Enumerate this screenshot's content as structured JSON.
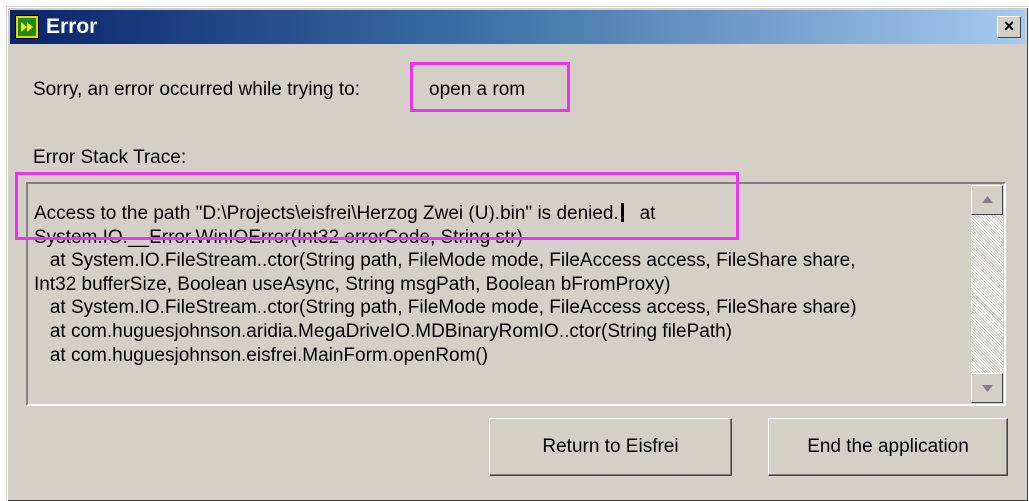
{
  "window": {
    "title": "Error",
    "close_glyph": "×"
  },
  "message": {
    "label": "Sorry, an error occurred while trying to:",
    "action": "open a rom"
  },
  "stack": {
    "label": "Error Stack Trace:",
    "lines": [
      "Access to the path \"D:\\Projects\\eisfrei\\Herzog Zwei (U).bin\" is denied.",
      "System.IO.__Error.WinIOError(Int32 errorCode, String str)",
      "   at System.IO.FileStream..ctor(String path, FileMode mode, FileAccess access, FileShare share,",
      "Int32 bufferSize, Boolean useAsync, String msgPath, Boolean bFromProxy)",
      "   at System.IO.FileStream..ctor(String path, FileMode mode, FileAccess access, FileShare share)",
      "   at com.huguesjohnson.aridia.MegaDriveIO.MDBinaryRomIO..ctor(String filePath)",
      "   at com.huguesjohnson.eisfrei.MainForm.openRom()"
    ],
    "line1_suffix": "   at"
  },
  "buttons": {
    "return_label": "Return to Eisfrei",
    "end_label": "End the application"
  },
  "icons": {
    "app": "app-icon",
    "close": "close-icon",
    "scroll_up": "arrow-up-icon",
    "scroll_down": "arrow-down-icon"
  },
  "colors": {
    "highlight": "#ee33ee",
    "title_bar_start": "#0a246a",
    "title_bar_end": "#a6caf0",
    "dialog_face": "#d4d0c8"
  }
}
